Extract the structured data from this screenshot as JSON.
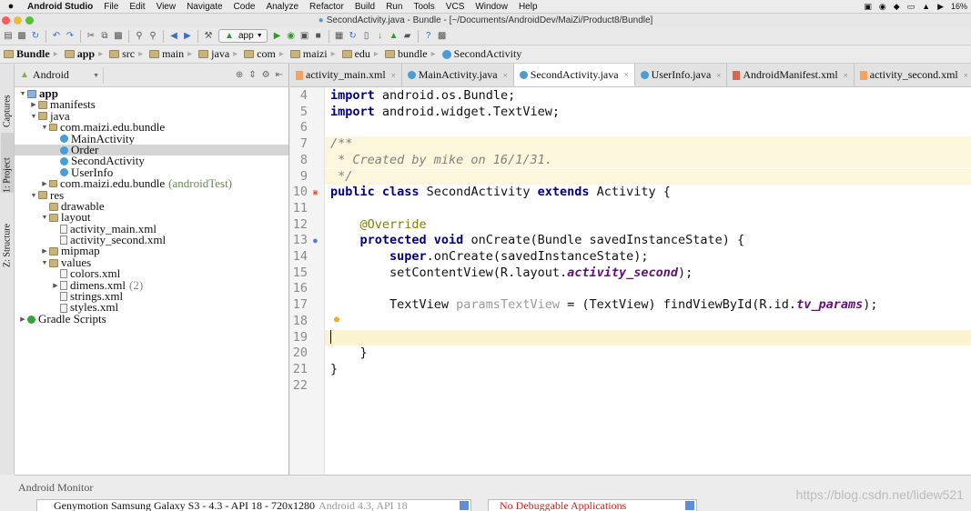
{
  "menubar": {
    "app_name": "Android Studio",
    "items": [
      "File",
      "Edit",
      "View",
      "Navigate",
      "Code",
      "Analyze",
      "Refactor",
      "Build",
      "Run",
      "Tools",
      "VCS",
      "Window",
      "Help"
    ],
    "battery": "16%"
  },
  "window": {
    "title": "SecondActivity.java - Bundle - [~/Documents/AndroidDev/MaiZi/Product8/Bundle]"
  },
  "toolbar": {
    "run_config": "app"
  },
  "breadcrumb": [
    "Bundle",
    "app",
    "src",
    "main",
    "java",
    "com",
    "maizi",
    "edu",
    "bundle",
    "SecondActivity"
  ],
  "left_tabs": {
    "captures": "Captures",
    "project": "1: Project",
    "structure": "Z: Structure"
  },
  "project_panel": {
    "view_mode": "Android",
    "tree": [
      {
        "label": "app",
        "depth": 0,
        "icon": "folder-blue",
        "expanded": true,
        "bold": true
      },
      {
        "label": "manifests",
        "depth": 1,
        "icon": "folder",
        "expanded": false
      },
      {
        "label": "java",
        "depth": 1,
        "icon": "folder",
        "expanded": true
      },
      {
        "label": "com.maizi.edu.bundle",
        "depth": 2,
        "icon": "pkg",
        "expanded": true
      },
      {
        "label": "MainActivity",
        "depth": 3,
        "icon": "class"
      },
      {
        "label": "Order",
        "depth": 3,
        "icon": "class",
        "selected": true
      },
      {
        "label": "SecondActivity",
        "depth": 3,
        "icon": "class"
      },
      {
        "label": "UserInfo",
        "depth": 3,
        "icon": "class"
      },
      {
        "label": "com.maizi.edu.bundle",
        "depth": 2,
        "icon": "pkg",
        "expanded": false,
        "suffix": "(androidTest)"
      },
      {
        "label": "res",
        "depth": 1,
        "icon": "folder",
        "expanded": true
      },
      {
        "label": "drawable",
        "depth": 2,
        "icon": "folder"
      },
      {
        "label": "layout",
        "depth": 2,
        "icon": "folder",
        "expanded": true
      },
      {
        "label": "activity_main.xml",
        "depth": 3,
        "icon": "xml"
      },
      {
        "label": "activity_second.xml",
        "depth": 3,
        "icon": "xml"
      },
      {
        "label": "mipmap",
        "depth": 2,
        "icon": "folder",
        "expanded": false
      },
      {
        "label": "values",
        "depth": 2,
        "icon": "folder",
        "expanded": true
      },
      {
        "label": "colors.xml",
        "depth": 3,
        "icon": "xml"
      },
      {
        "label": "dimens.xml",
        "depth": 3,
        "icon": "xml",
        "expanded": false,
        "count": "(2)"
      },
      {
        "label": "strings.xml",
        "depth": 3,
        "icon": "xml"
      },
      {
        "label": "styles.xml",
        "depth": 3,
        "icon": "xml"
      },
      {
        "label": "Gradle Scripts",
        "depth": 0,
        "icon": "gradle",
        "expanded": false
      }
    ]
  },
  "editor": {
    "tabs": [
      {
        "label": "activity_main.xml",
        "type": "xml"
      },
      {
        "label": "MainActivity.java",
        "type": "java"
      },
      {
        "label": "SecondActivity.java",
        "type": "java",
        "active": true
      },
      {
        "label": "UserInfo.java",
        "type": "java"
      },
      {
        "label": "AndroidManifest.xml",
        "type": "manifest"
      },
      {
        "label": "activity_second.xml",
        "type": "xml"
      }
    ],
    "lines": [
      {
        "n": "4",
        "tokens": [
          [
            "kw",
            "import"
          ],
          [
            "t",
            " android.os.Bundle;"
          ]
        ]
      },
      {
        "n": "5",
        "tokens": [
          [
            "kw",
            "import"
          ],
          [
            "t",
            " android.widget.TextView;"
          ]
        ]
      },
      {
        "n": "6",
        "tokens": []
      },
      {
        "n": "7",
        "doc": true,
        "tokens": [
          [
            "cm",
            "/**"
          ]
        ]
      },
      {
        "n": "8",
        "doc": true,
        "tokens": [
          [
            "cm",
            " * Created by mike on 16/1/31."
          ]
        ]
      },
      {
        "n": "9",
        "doc": true,
        "tokens": [
          [
            "cm",
            " */"
          ]
        ]
      },
      {
        "n": "10",
        "tokens": [
          [
            "kw",
            "public class"
          ],
          [
            "t",
            " SecondActivity "
          ],
          [
            "kw",
            "extends"
          ],
          [
            "t",
            " Activity {"
          ]
        ]
      },
      {
        "n": "11",
        "tokens": []
      },
      {
        "n": "12",
        "tokens": [
          [
            "t",
            "    "
          ],
          [
            "ann",
            "@Override"
          ]
        ]
      },
      {
        "n": "13",
        "tokens": [
          [
            "t",
            "    "
          ],
          [
            "kw",
            "protected void"
          ],
          [
            "t",
            " onCreate(Bundle savedInstanceState) {"
          ]
        ]
      },
      {
        "n": "14",
        "tokens": [
          [
            "t",
            "        "
          ],
          [
            "kw",
            "super"
          ],
          [
            "t",
            ".onCreate(savedInstanceState);"
          ]
        ]
      },
      {
        "n": "15",
        "tokens": [
          [
            "t",
            "        setContentView(R.layout."
          ],
          [
            "sf",
            "activity_second"
          ],
          [
            "t",
            ");"
          ]
        ]
      },
      {
        "n": "16",
        "tokens": []
      },
      {
        "n": "17",
        "tokens": [
          [
            "t",
            "        TextView "
          ],
          [
            "unused",
            "paramsTextView"
          ],
          [
            "t",
            " = (TextView) findViewById(R.id."
          ],
          [
            "sf",
            "tv_params"
          ],
          [
            "t",
            ");"
          ]
        ]
      },
      {
        "n": "18",
        "tokens": []
      },
      {
        "n": "19",
        "current": true,
        "tokens": []
      },
      {
        "n": "20",
        "tokens": [
          [
            "t",
            "    }"
          ]
        ]
      },
      {
        "n": "21",
        "tokens": [
          [
            "t",
            "}"
          ]
        ]
      },
      {
        "n": "22",
        "tokens": []
      }
    ]
  },
  "monitor": {
    "title": "Android Monitor",
    "device": "Genymotion Samsung Galaxy S3 - 4.3 - API 18 - 720x1280",
    "device_sub": "Android 4.3, API 18",
    "app": "No Debuggable Applications"
  },
  "watermark": "https://blog.csdn.net/lidew521",
  "colors": {
    "keyword": "#000080",
    "annotation": "#808000",
    "comment": "#808080",
    "static_field": "#660e7a",
    "error_text": "#cc2222"
  }
}
